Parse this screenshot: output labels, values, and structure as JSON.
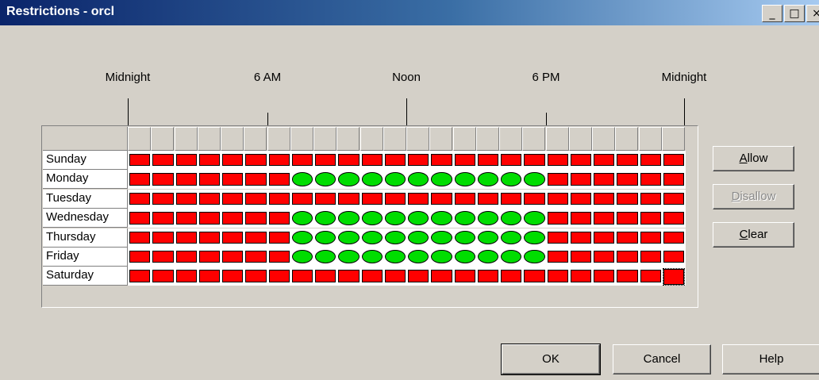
{
  "window": {
    "title": "Restrictions - orcl",
    "controls": {
      "minimize": "_",
      "maximize": "□",
      "close": "×"
    }
  },
  "time_labels": [
    "Midnight",
    "6 AM",
    "Noon",
    "6 PM",
    "Midnight"
  ],
  "days": [
    {
      "label": "Sunday",
      "allowed_hours": []
    },
    {
      "label": "Monday",
      "allowed_hours": [
        7,
        8,
        9,
        10,
        11,
        12,
        13,
        14,
        15,
        16,
        17
      ]
    },
    {
      "label": "Tuesday",
      "allowed_hours": []
    },
    {
      "label": "Wednesday",
      "allowed_hours": [
        7,
        8,
        9,
        10,
        11,
        12,
        13,
        14,
        15,
        16,
        17
      ]
    },
    {
      "label": "Thursday",
      "allowed_hours": [
        7,
        8,
        9,
        10,
        11,
        12,
        13,
        14,
        15,
        16,
        17
      ]
    },
    {
      "label": "Friday",
      "allowed_hours": [
        7,
        8,
        9,
        10,
        11,
        12,
        13,
        14,
        15,
        16,
        17
      ]
    },
    {
      "label": "Saturday",
      "allowed_hours": []
    }
  ],
  "hours_per_day": 24,
  "selected_cell": {
    "day": "Saturday",
    "hour": 23
  },
  "colors": {
    "denied": "#ff0000",
    "allowed": "#00dd00",
    "titlebar_start": "#0a246a",
    "titlebar_end": "#a6caf0",
    "dialog_bg": "#d4d0c8"
  },
  "side_buttons": {
    "allow": {
      "mnemonic": "A",
      "rest": "llow",
      "enabled": true
    },
    "disallow": {
      "mnemonic": "D",
      "rest": "isallow",
      "enabled": false
    },
    "clear": {
      "mnemonic": "C",
      "rest": "lear",
      "enabled": true
    }
  },
  "footer_buttons": {
    "ok": "OK",
    "cancel": "Cancel",
    "help": "Help"
  }
}
